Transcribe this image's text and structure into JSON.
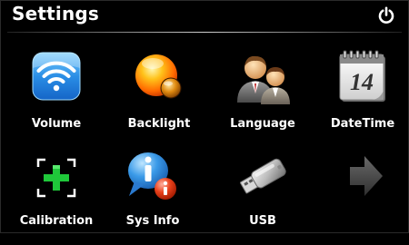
{
  "header": {
    "title": "Settings"
  },
  "icons": {
    "power": "power-icon"
  },
  "tiles": [
    {
      "label": "Volume",
      "icon": "volume-wifi-icon"
    },
    {
      "label": "Backlight",
      "icon": "backlight-orb-icon"
    },
    {
      "label": "Language",
      "icon": "language-people-icon"
    },
    {
      "label": "DateTime",
      "icon": "calendar-icon"
    },
    {
      "label": "Calibration",
      "icon": "calibration-crosshair-icon"
    },
    {
      "label": "Sys Info",
      "icon": "info-bubble-icon"
    },
    {
      "label": "USB",
      "icon": "usb-drive-icon"
    },
    {
      "label": "",
      "icon": "next-arrow-icon"
    }
  ],
  "calendar": {
    "day": "14"
  }
}
